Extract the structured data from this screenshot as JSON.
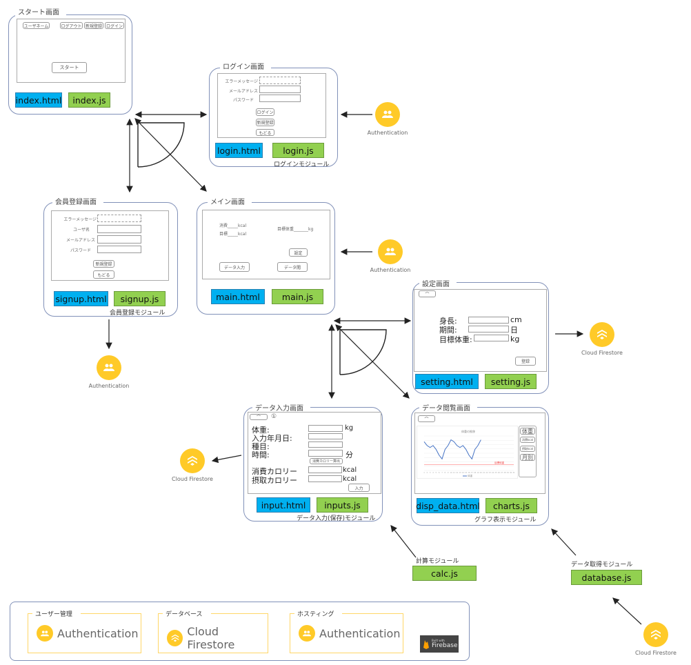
{
  "start": {
    "title": "スタート画面",
    "buttons": [
      "ユーザネーム",
      "ログアウト",
      "新規登録",
      "ログイン"
    ],
    "start_button": "スタート",
    "html": "index.html",
    "js": "index.js"
  },
  "login": {
    "title": "ログイン画面",
    "labels": [
      "エラーメッセージ",
      "メールアドレス",
      "パスワード"
    ],
    "buttons": [
      "ログイン",
      "新規登録",
      "もどる"
    ],
    "html": "login.html",
    "js": "login.js",
    "caption": "ログインモジュール"
  },
  "signup": {
    "title": "会員登録画面",
    "labels": [
      "エラーメッセージ",
      "ユーザ名",
      "メールアドレス",
      "パスワード"
    ],
    "buttons": [
      "新規登録",
      "もどる"
    ],
    "html": "signup.html",
    "js": "signup.js",
    "caption": "会員登録モジュール"
  },
  "main": {
    "title": "メイン画面",
    "consume": "消費_____kcal",
    "target": "目標_____kcal",
    "target_weight": "目標体重_______kg",
    "settings_button": "設定",
    "input_button": "データ入力",
    "view_button": "データ閲",
    "html": "main.html",
    "js": "main.js"
  },
  "setting": {
    "title": "設定画面",
    "rows": [
      {
        "label": "身長:",
        "unit": "cm"
      },
      {
        "label": "期間:",
        "unit": "日"
      },
      {
        "label": "目標体重:",
        "unit": "kg"
      }
    ],
    "register_button": "登録",
    "html": "setting.html",
    "js": "setting.js"
  },
  "input": {
    "title": "データ入力画面",
    "marker": "①",
    "rows": [
      {
        "label": "体重:",
        "unit": "kg"
      },
      {
        "label": "入力年月日:",
        "unit": ""
      },
      {
        "label": "種目:",
        "unit": ""
      },
      {
        "label": "時間:",
        "unit": "分"
      }
    ],
    "calc_button": "消費カロリー算出",
    "rows2": [
      {
        "label": "消費カロリー",
        "unit": "kcal"
      },
      {
        "label": "摂取カロリー",
        "unit": "kcal"
      }
    ],
    "submit_button": "入力",
    "html": "input.html",
    "js": "inputs.js",
    "caption": "データ入力(保存)モジュール"
  },
  "view": {
    "title": "データ閲覧画面",
    "side_buttons": [
      "体重",
      "消費kcal",
      "摂取kcal",
      "月別"
    ],
    "html": "disp_data.html",
    "js": "charts.js",
    "caption": "グラフ表示モジュール"
  },
  "chart_data": {
    "type": "line",
    "title": "体重の推移",
    "series": [
      {
        "name": "体重",
        "values": [
          72,
          70,
          69,
          70,
          68,
          65,
          63,
          68,
          70,
          73,
          72,
          70,
          69,
          70,
          68,
          65,
          63,
          68,
          70,
          73
        ]
      }
    ],
    "x": [
      1,
      2,
      3,
      4,
      5,
      6,
      7,
      8,
      9,
      10,
      11,
      12,
      13,
      14,
      15,
      16,
      17,
      18,
      19,
      20
    ],
    "x_range": [
      1,
      31
    ],
    "ylim": [
      57,
      75
    ],
    "target_line": {
      "label": "目標体重",
      "value": 60,
      "color": "#ff8080"
    },
    "line_color": "#4472c4",
    "grid": true
  },
  "calc": {
    "label": "計算モジュール",
    "js": "calc.js"
  },
  "database": {
    "label": "データ取得モジュール",
    "js": "database.js"
  },
  "services": {
    "auth": "Authentication",
    "firestore": "Cloud Firestore"
  },
  "legend": {
    "user_mgmt": "ユーザー管理",
    "database": "データベース",
    "hosting": "ホスティング",
    "auth": "Authentication",
    "firestore": "Cloud Firestore",
    "hosting_service": "Authentication",
    "badge_small": "Built with",
    "badge_big": "Firebase"
  },
  "colors": {
    "html": "#00b0f0",
    "js": "#92d050",
    "firebase_yellow": "#ffca28",
    "frame": "#8090b8"
  }
}
